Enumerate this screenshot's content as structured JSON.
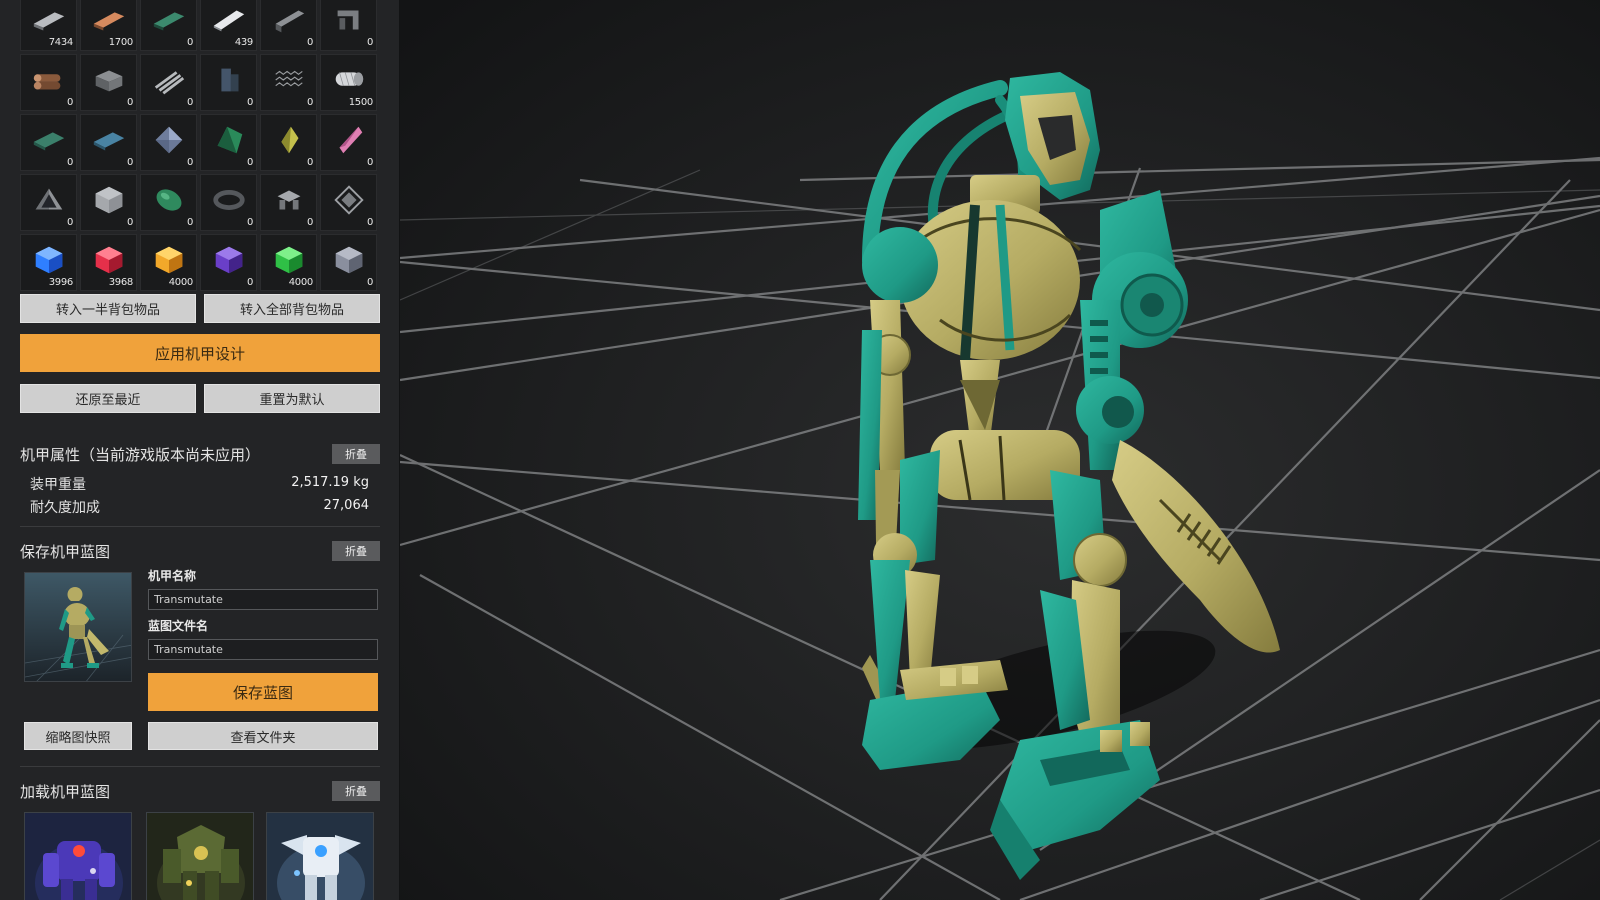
{
  "inventory": [
    {
      "icon": "steel-plate-icon",
      "count": "7434"
    },
    {
      "icon": "copper-plate-icon",
      "count": "1700"
    },
    {
      "icon": "green-plate-icon",
      "count": "0"
    },
    {
      "icon": "titanium-plate-icon",
      "count": "439"
    },
    {
      "icon": "steel-beam-icon",
      "count": "0"
    },
    {
      "icon": "frame-part-icon",
      "count": "0"
    },
    {
      "icon": "log-icon",
      "count": "0"
    },
    {
      "icon": "stone-brick-icon",
      "count": "0"
    },
    {
      "icon": "rods-icon",
      "count": "0"
    },
    {
      "icon": "pillar-icon",
      "count": "0"
    },
    {
      "icon": "graphene-icon",
      "count": "0"
    },
    {
      "icon": "carbon-nanotube-icon",
      "count": "1500"
    },
    {
      "icon": "glass-plate-icon",
      "count": "0"
    },
    {
      "icon": "blue-glass-icon",
      "count": "0"
    },
    {
      "icon": "diamond-icon",
      "count": "0"
    },
    {
      "icon": "emerald-crystal-icon",
      "count": "0"
    },
    {
      "icon": "yellow-crystal-icon",
      "count": "0"
    },
    {
      "icon": "pink-crystal-icon",
      "count": "0"
    },
    {
      "icon": "prism-icon",
      "count": "0"
    },
    {
      "icon": "silicon-cube-icon",
      "count": "0"
    },
    {
      "icon": "green-stone-icon",
      "count": "0"
    },
    {
      "icon": "ring-icon",
      "count": "0"
    },
    {
      "icon": "drone-part-icon",
      "count": "0"
    },
    {
      "icon": "processor-icon",
      "count": "0"
    },
    {
      "icon": "blue-cube-icon",
      "count": "3996"
    },
    {
      "icon": "red-cube-icon",
      "count": "3968"
    },
    {
      "icon": "yellow-cube-icon",
      "count": "4000"
    },
    {
      "icon": "purple-cube-icon",
      "count": "0"
    },
    {
      "icon": "green-cube-icon",
      "count": "4000"
    },
    {
      "icon": "gray-cube-icon",
      "count": "0"
    }
  ],
  "buttons": {
    "transfer_half": "转入一半背包物品",
    "transfer_all": "转入全部背包物品",
    "apply_design": "应用机甲设计",
    "restore_recent": "还原至最近",
    "reset_default": "重置为默认"
  },
  "properties": {
    "title": "机甲属性（当前游戏版本尚未应用）",
    "fold": "折叠",
    "rows": [
      {
        "label": "装甲重量",
        "value": "2,517.19 kg"
      },
      {
        "label": "耐久度加成",
        "value": "27,064"
      }
    ]
  },
  "save_blueprint": {
    "title": "保存机甲蓝图",
    "fold": "折叠",
    "mech_name_label": "机甲名称",
    "mech_name_value": "Transmutate",
    "file_name_label": "蓝图文件名",
    "file_name_value": "Transmutate",
    "save_button": "保存蓝图",
    "snapshot_button": "缩略图快照",
    "open_folder_button": "查看文件夹"
  },
  "load_blueprint": {
    "title": "加载机甲蓝图",
    "fold": "折叠",
    "thumbnails": [
      "purple-mech-thumbnail",
      "olive-mech-thumbnail",
      "white-mech-thumbnail"
    ]
  },
  "colors": {
    "accent": "#f0a23b",
    "mech_primary": "#1f9a86",
    "mech_secondary": "#b5ab63",
    "background": "#1b1c1d"
  }
}
